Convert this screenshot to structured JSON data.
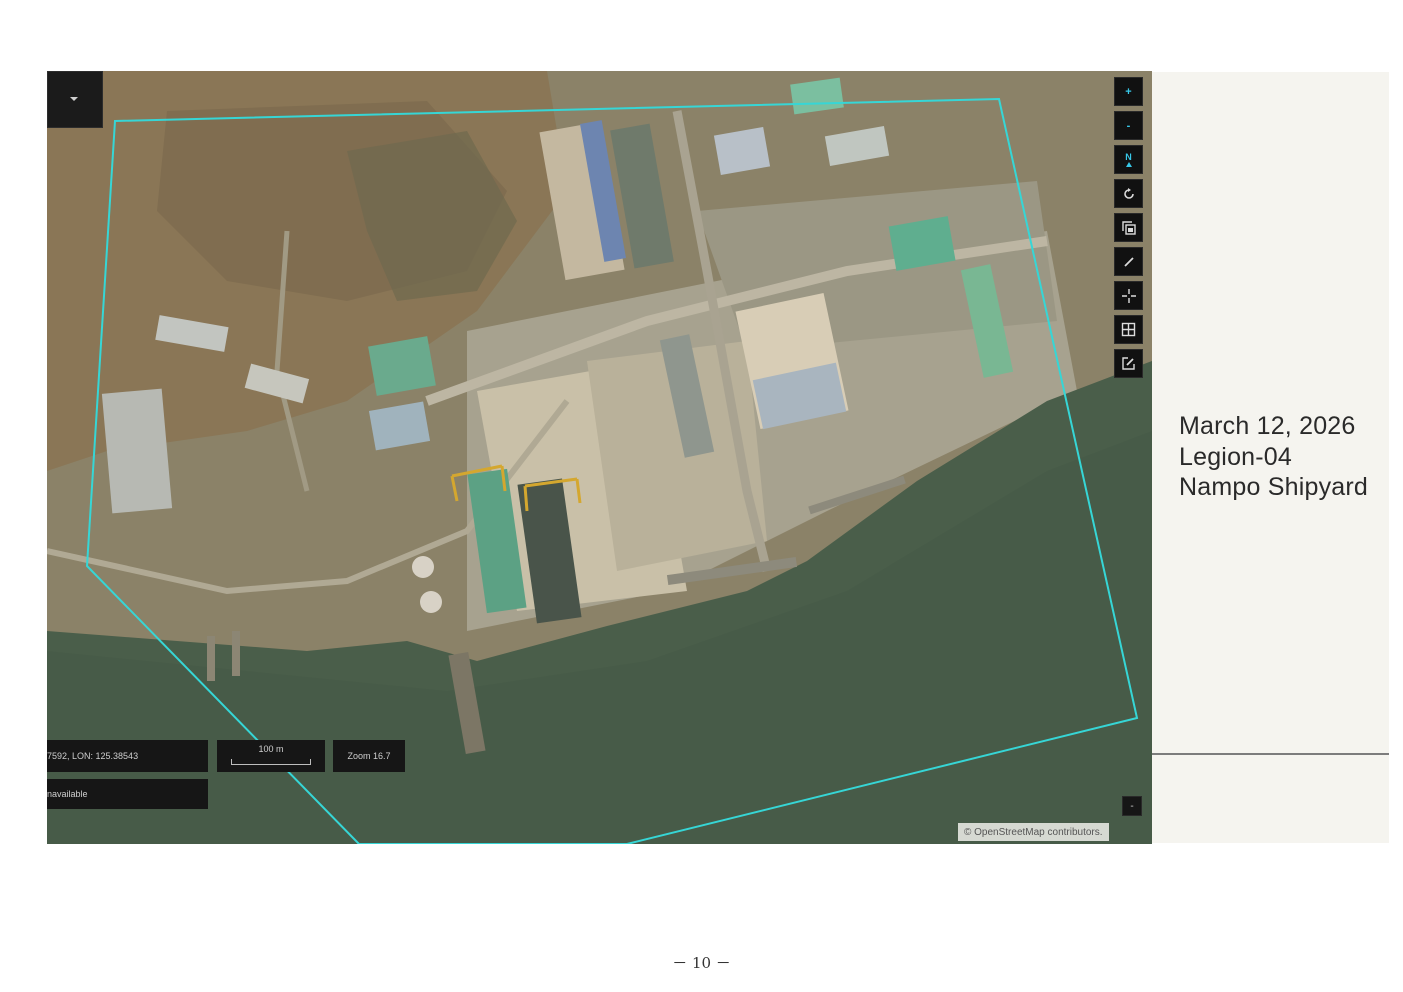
{
  "map": {
    "coords_readout": "7592, LON: 125.38543",
    "status_readout": "navailable",
    "scale_label": "100 m",
    "zoom_label": "Zoom 16.7",
    "attribution": "© OpenStreetMap contributors.",
    "collapse_symbol": "-",
    "aoi_color": "#36d6d6",
    "toolbar": [
      {
        "name": "zoom-in-icon",
        "symbol": "+"
      },
      {
        "name": "zoom-out-icon",
        "symbol": "-"
      },
      {
        "name": "north-arrow-icon",
        "symbol": "N"
      },
      {
        "name": "reset-rotation-icon"
      },
      {
        "name": "layers-icon"
      },
      {
        "name": "draw-line-icon"
      },
      {
        "name": "crosshair-icon"
      },
      {
        "name": "grid-icon"
      },
      {
        "name": "edit-icon"
      }
    ]
  },
  "info": {
    "date": "March 12, 2026",
    "unit": "Legion-04",
    "location": "Nampo Shipyard"
  },
  "page_number": "－ 10 －"
}
